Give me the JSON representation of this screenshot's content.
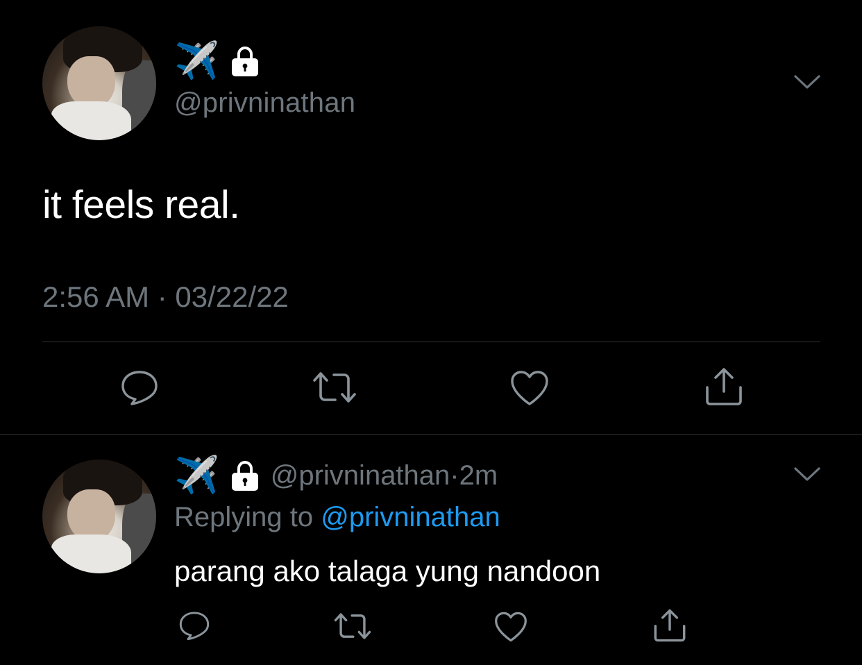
{
  "main_tweet": {
    "name_emoji": "✈️",
    "handle": "@privninathan",
    "text": "it feels real.",
    "timestamp": "2:56 AM · 03/22/22",
    "actions": [
      "reply-icon",
      "retweet-icon",
      "like-icon",
      "share-icon"
    ]
  },
  "reply_tweet": {
    "name_emoji": "✈️",
    "handle": "@privninathan",
    "separator": " · ",
    "age": "2m",
    "replying_prefix": "Replying to ",
    "replying_to": "@privninathan",
    "text": "parang ako talaga yung nandoon",
    "actions": [
      "reply-icon",
      "retweet-icon",
      "like-icon",
      "share-icon"
    ]
  },
  "colors": {
    "background": "#000000",
    "text_primary": "#ffffff",
    "text_secondary": "#6e767d",
    "link": "#1d9bf0",
    "divider": "#2f3336"
  }
}
